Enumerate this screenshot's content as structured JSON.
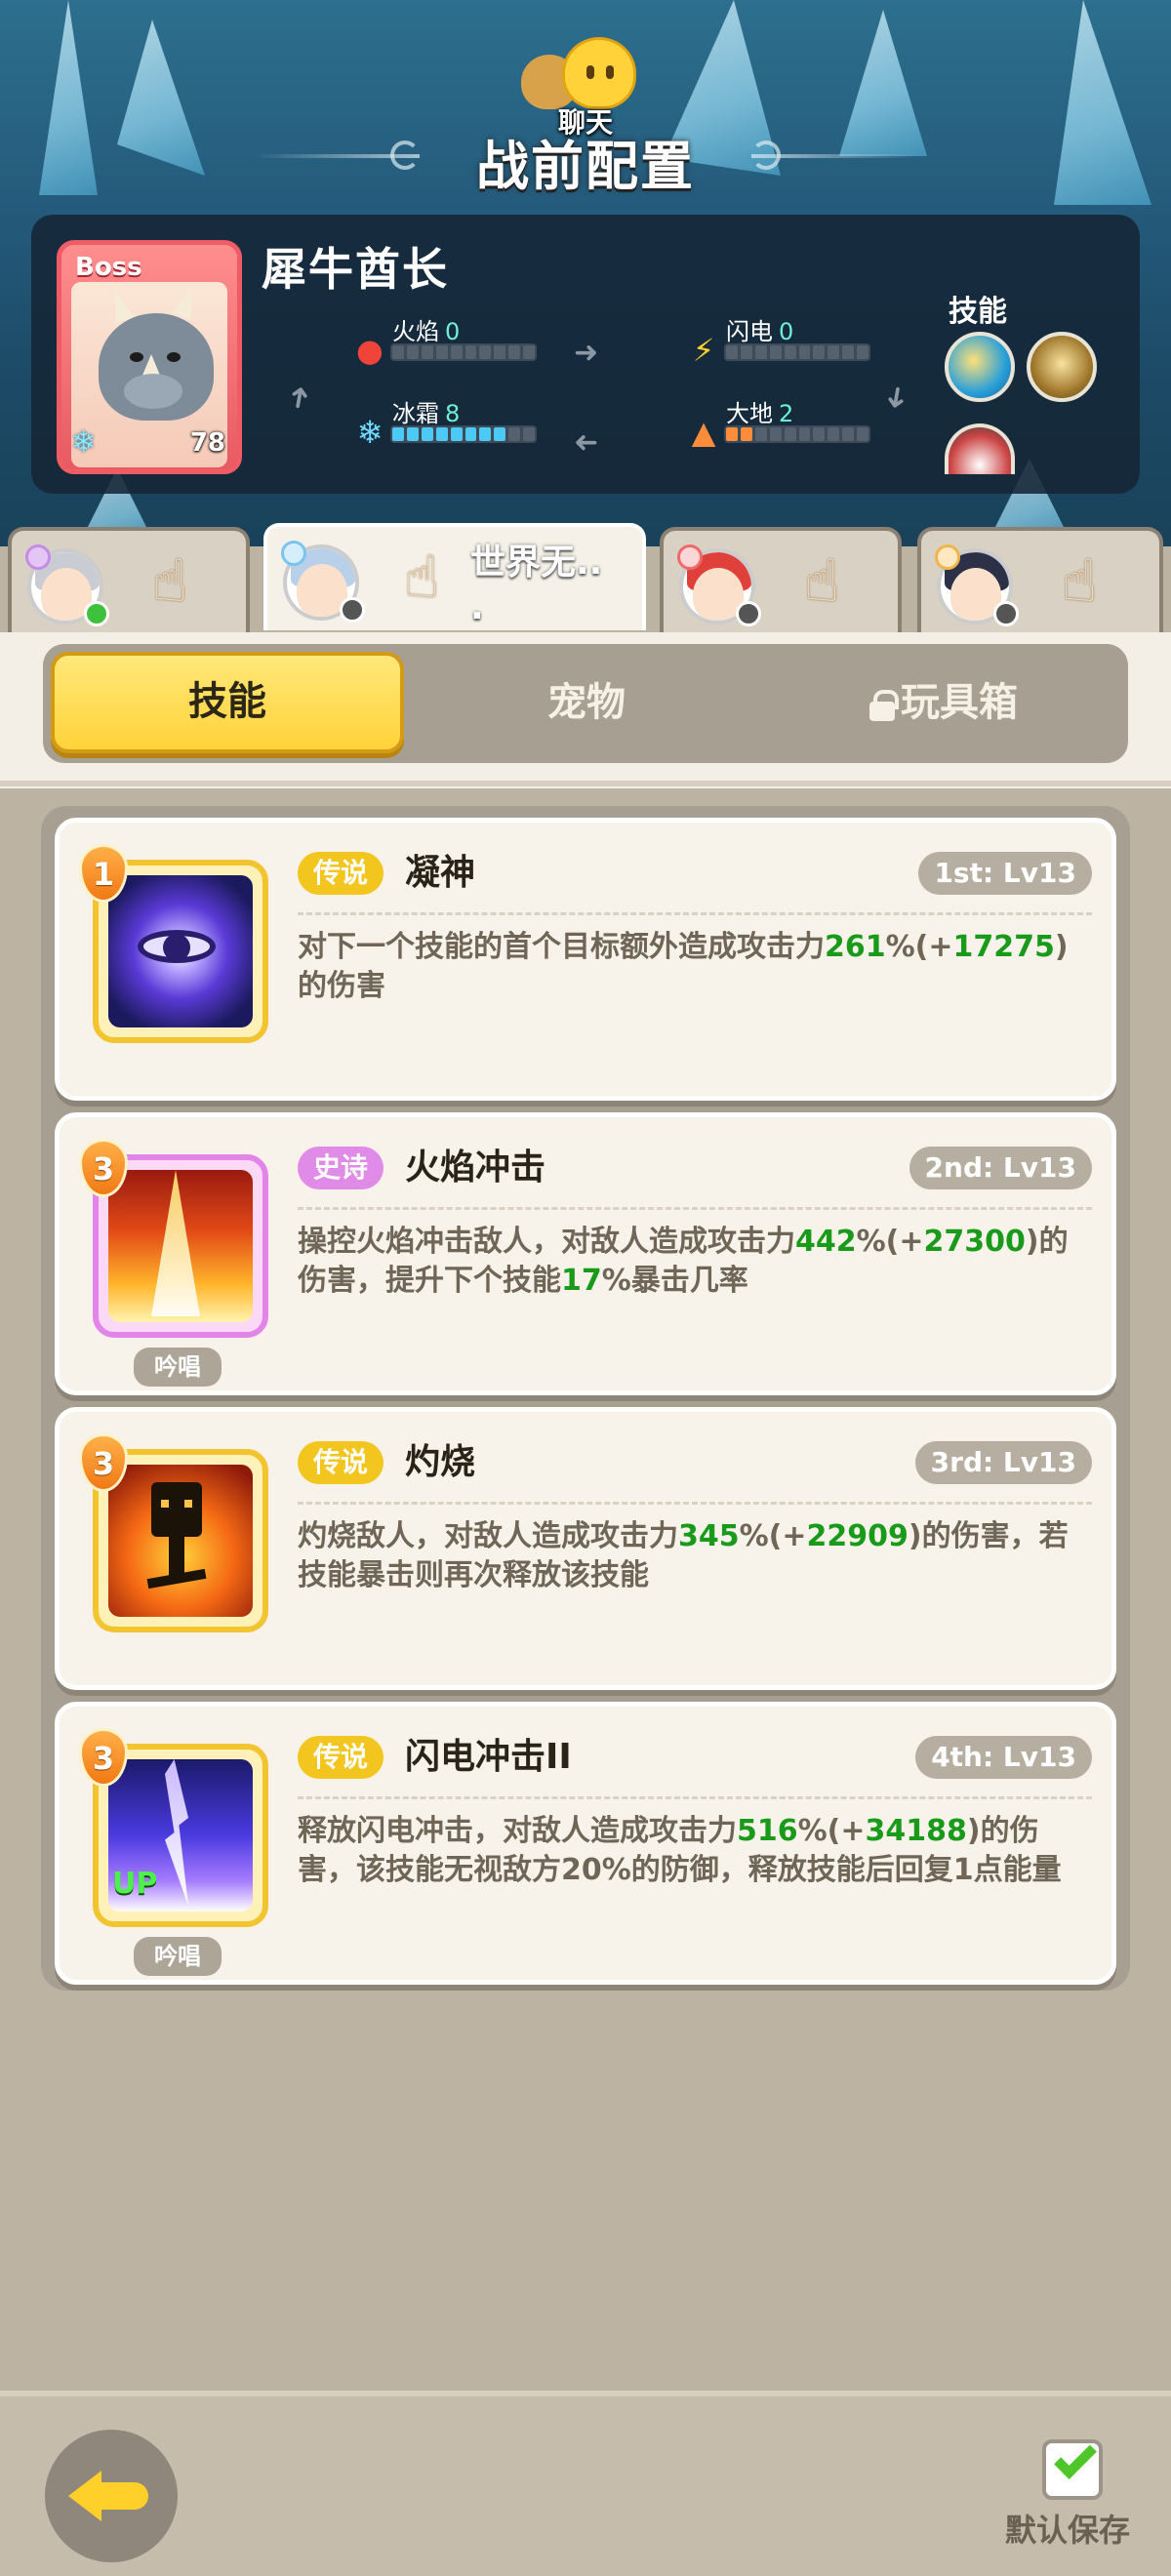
{
  "header": {
    "chat_label": "聊天",
    "title": "战前配置"
  },
  "boss": {
    "tag": "Boss",
    "name": "犀牛酋长",
    "level": "78",
    "stats": {
      "fire": {
        "label": "火焰",
        "value": "0",
        "filled": 0
      },
      "lightning": {
        "label": "闪电",
        "value": "0",
        "filled": 0
      },
      "ice": {
        "label": "冰霜",
        "value": "8",
        "filled": 8
      },
      "earth": {
        "label": "大地",
        "value": "2",
        "filled": 2
      }
    },
    "skills_label": "技能"
  },
  "hero_tabs": [
    {
      "name": "",
      "active": false
    },
    {
      "name": "世界无..\n.",
      "active": true
    },
    {
      "name": "",
      "active": false
    },
    {
      "name": "",
      "active": false
    }
  ],
  "segments": {
    "skills": "技能",
    "pets": "宠物",
    "toybox": "玩具箱"
  },
  "skills": [
    {
      "rank": "1",
      "rarity": "传说",
      "name": "凝神",
      "order": "1st: Lv13",
      "desc_parts": [
        "对下一个技能的首个目标额外造成攻击力",
        "261",
        "%(+",
        "17275",
        ")的伤害"
      ],
      "chant": ""
    },
    {
      "rank": "3",
      "rarity": "史诗",
      "name": "火焰冲击",
      "order": "2nd: Lv13",
      "desc_parts": [
        "操控火焰冲击敌人，对敌人造成攻击力",
        "442",
        "%(+",
        "27300",
        ")的伤害，提升下个技能",
        "17",
        "%暴击几率"
      ],
      "chant": "吟唱"
    },
    {
      "rank": "3",
      "rarity": "传说",
      "name": "灼烧",
      "order": "3rd: Lv13",
      "desc_parts": [
        "灼烧敌人，对敌人造成攻击力",
        "345",
        "%(+",
        "22909",
        ")的伤害，若技能暴击则再次释放该技能"
      ],
      "chant": ""
    },
    {
      "rank": "3",
      "rarity": "传说",
      "name": "闪电冲击II",
      "order": "4th: Lv13",
      "desc_parts": [
        "释放闪电冲击，对敌人造成攻击力",
        "516",
        "%(+",
        "34188",
        ")的伤害，该技能无视敌方20%的防御，释放技能后回复1点能量"
      ],
      "chant": "吟唱",
      "badge": "UP"
    }
  ],
  "footer": {
    "save_label": "默认保存"
  },
  "colors": {
    "legend": "#f2c61f",
    "epic": "#e18be8",
    "highlight": "#1a9a1a",
    "active_tab": "#ffd23a"
  }
}
